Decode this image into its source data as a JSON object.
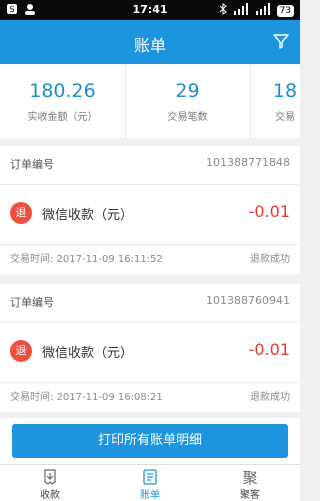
{
  "status_bar": {
    "time": "17:41",
    "battery": "73"
  },
  "header": {
    "title": "账单"
  },
  "stats": [
    {
      "value": "180.26",
      "label": "实收金额（元）"
    },
    {
      "value": "29",
      "label": "交易笔数"
    },
    {
      "value": "18",
      "label": "交易"
    }
  ],
  "orders": [
    {
      "order_label": "订单编号",
      "order_id": "101388771848",
      "refund_tag": "退",
      "name": "微信收款（元）",
      "amount": "-0.01",
      "time_label": "交易时间:",
      "time": "2017-11-09 16:11:52",
      "status": "退款成功"
    },
    {
      "order_label": "订单编号",
      "order_id": "101388760941",
      "refund_tag": "退",
      "name": "微信收款（元）",
      "amount": "-0.01",
      "time_label": "交易时间:",
      "time": "2017-11-09 16:08:21",
      "status": "退款成功"
    }
  ],
  "print_button": "打印所有账单明细",
  "tabs": [
    {
      "label": "收款",
      "icon": "download-receipt-icon"
    },
    {
      "label": "账单",
      "icon": "bill-icon"
    },
    {
      "label": "聚客",
      "icon": "gather-customer-icon"
    }
  ],
  "colors": {
    "brand": "#1d94de",
    "stat_value": "#1d8fc8",
    "refund": "#f14d41",
    "amount_negative": "#e53b2c"
  }
}
